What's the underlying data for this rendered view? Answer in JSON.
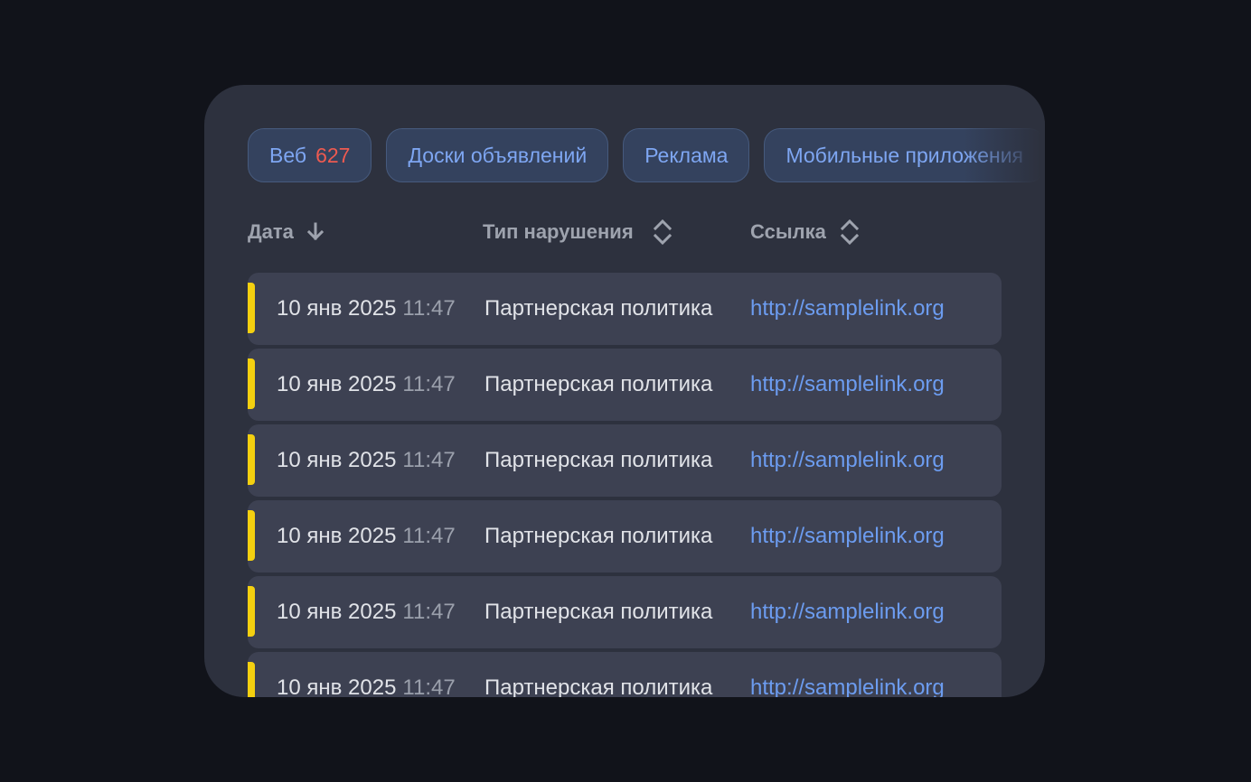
{
  "tabs": [
    {
      "label": "Веб",
      "count": "627"
    },
    {
      "label": "Доски объявлений"
    },
    {
      "label": "Реклама"
    },
    {
      "label": "Мобильные приложения"
    }
  ],
  "table": {
    "columns": [
      {
        "label": "Дата",
        "sort": "arrow-down-icon"
      },
      {
        "label": "Тип нарушения",
        "sort": "sort-updown-icon"
      },
      {
        "label": "Ссылка",
        "sort": "sort-updown-icon"
      }
    ],
    "rows": [
      {
        "date": "10 янв 2025",
        "time": "11:47",
        "type": "Партнерская политика",
        "link": "http://samplelink.org"
      },
      {
        "date": "10 янв 2025",
        "time": "11:47",
        "type": "Партнерская политика",
        "link": "http://samplelink.org"
      },
      {
        "date": "10 янв 2025",
        "time": "11:47",
        "type": "Партнерская политика",
        "link": "http://samplelink.org"
      },
      {
        "date": "10 янв 2025",
        "time": "11:47",
        "type": "Партнерская политика",
        "link": "http://samplelink.org"
      },
      {
        "date": "10 янв 2025",
        "time": "11:47",
        "type": "Партнерская политика",
        "link": "http://samplelink.org"
      },
      {
        "date": "10 янв 2025",
        "time": "11:47",
        "type": "Партнерская политика",
        "link": "http://samplelink.org"
      }
    ]
  },
  "colors": {
    "background": "#11131a",
    "card": "#2d313e",
    "row": "#3d4152",
    "accent_link": "#6c9cf0",
    "count_red": "#ee5a50",
    "status_marker": "#f4d010"
  }
}
